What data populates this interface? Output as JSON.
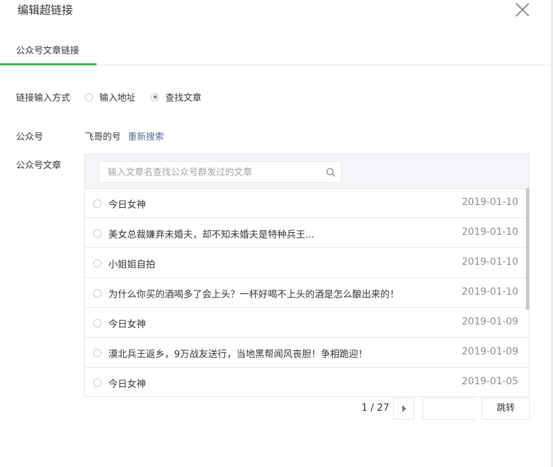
{
  "dialog": {
    "title": "编辑超链接"
  },
  "tabs": [
    {
      "label": "公众号文章链接"
    }
  ],
  "link_method": {
    "label": "链接输入方式",
    "options": [
      {
        "label": "输入地址",
        "checked": false
      },
      {
        "label": "查找文章",
        "checked": true
      }
    ]
  },
  "account": {
    "label": "公众号",
    "name": "飞哥的号",
    "research_link": "重新搜索"
  },
  "articles": {
    "label": "公众号文章",
    "search_placeholder": "输入文章名查找公众号群发过的文章",
    "items": [
      {
        "title": "今日女神",
        "date": "2019-01-10"
      },
      {
        "title": "美女总裁嫌弃未婚夫，却不知未婚夫是特种兵王...",
        "date": "2019-01-10"
      },
      {
        "title": "小姐姐自拍",
        "date": "2019-01-10"
      },
      {
        "title": "为什么你买的酒喝多了会上头？一杯好喝不上头的酒是怎么酿出来的！",
        "date": "2019-01-10"
      },
      {
        "title": "今日女神",
        "date": "2019-01-09"
      },
      {
        "title": "漠北兵王返乡，9万战友送行，当地黑帮闻风丧胆！争相跪迎！",
        "date": "2019-01-09"
      },
      {
        "title": "今日女神",
        "date": "2019-01-05"
      }
    ]
  },
  "pagination": {
    "page_info": "1 / 27",
    "jump_label": "跳转"
  },
  "colors": {
    "accent": "#44b549",
    "link": "#576b95",
    "date": "#8d8d8d"
  }
}
